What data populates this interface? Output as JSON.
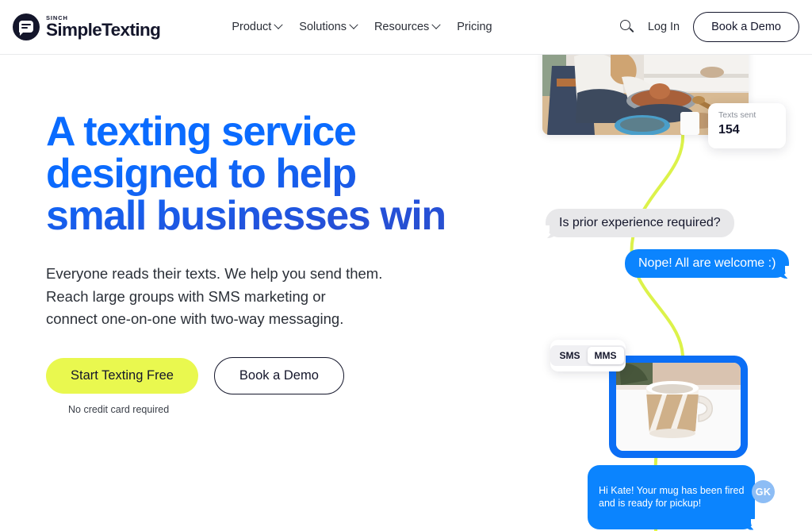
{
  "brand": {
    "sinch_label": "SINCH",
    "name": "SimpleTexting",
    "logo_icon": "speech-bubble-icon"
  },
  "nav": {
    "items": [
      {
        "label": "Product",
        "has_dropdown": true
      },
      {
        "label": "Solutions",
        "has_dropdown": true
      },
      {
        "label": "Resources",
        "has_dropdown": true
      },
      {
        "label": "Pricing",
        "has_dropdown": false
      }
    ]
  },
  "header_right": {
    "search_icon": "search-icon",
    "login_label": "Log In",
    "demo_label": "Book a Demo"
  },
  "hero": {
    "headline": "A texting service\ndesigned to help\nsmall businesses win",
    "subhead": "Everyone reads their texts. We help you send them.\nReach large groups with SMS marketing or\nconnect one-on-one with two-way messaging.",
    "primary_cta": "Start Texting Free",
    "secondary_cta": "Book a Demo",
    "note": "No credit card required"
  },
  "illustration": {
    "photo_alt": "potter-at-wheel-photo",
    "stat": {
      "label": "Texts sent",
      "value": "154"
    },
    "messages": [
      {
        "direction": "incoming",
        "text": "Is prior experience required?"
      },
      {
        "direction": "outgoing",
        "text": "Nope! All are welcome :)"
      }
    ],
    "message_type_toggle": {
      "options": [
        "SMS",
        "MMS"
      ],
      "selected": "MMS"
    },
    "mug_photo_alt": "striped-ceramic-mug-photo",
    "mug_message": "Hi Kate! Your mug has been fired\nand is ready for pickup!",
    "avatar_initials": "GK"
  },
  "colors": {
    "accent_lime": "#E9F84F",
    "accent_blue": "#0B84FE",
    "headline_blue_top": "#0A6BFF",
    "headline_blue_bottom": "#2B4FC8",
    "frame_blue": "#0B6EF5",
    "ink": "#14162B"
  }
}
